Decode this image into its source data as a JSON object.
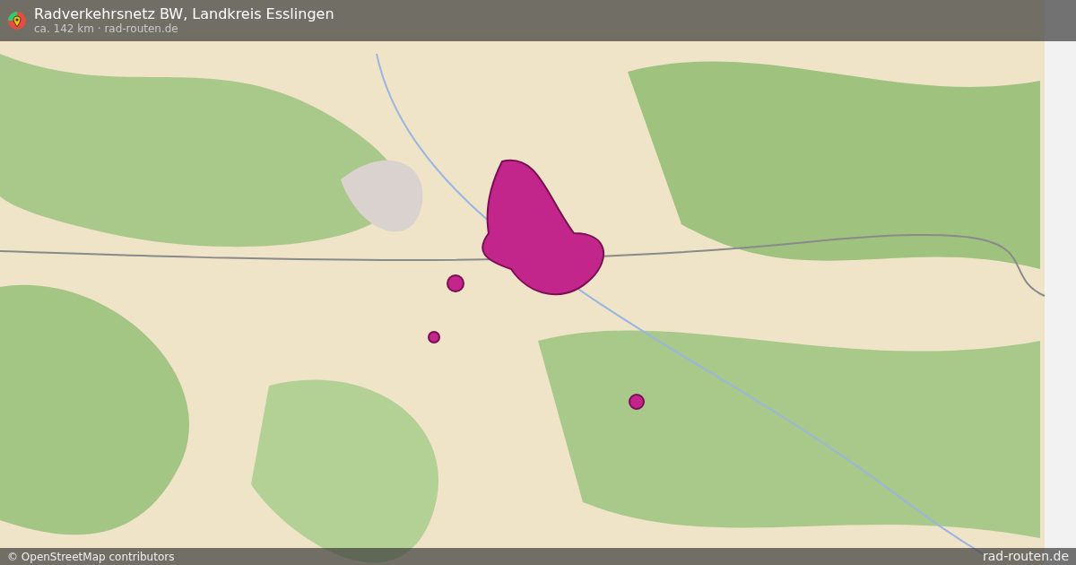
{
  "header": {
    "title": "Radverkehrsnetz BW, Landkreis Esslingen",
    "subtitle": "ca. 142 km · rad-routen.de"
  },
  "footer": {
    "attribution": "© OpenStreetMap contributors",
    "brand": "rad-routen.de"
  }
}
